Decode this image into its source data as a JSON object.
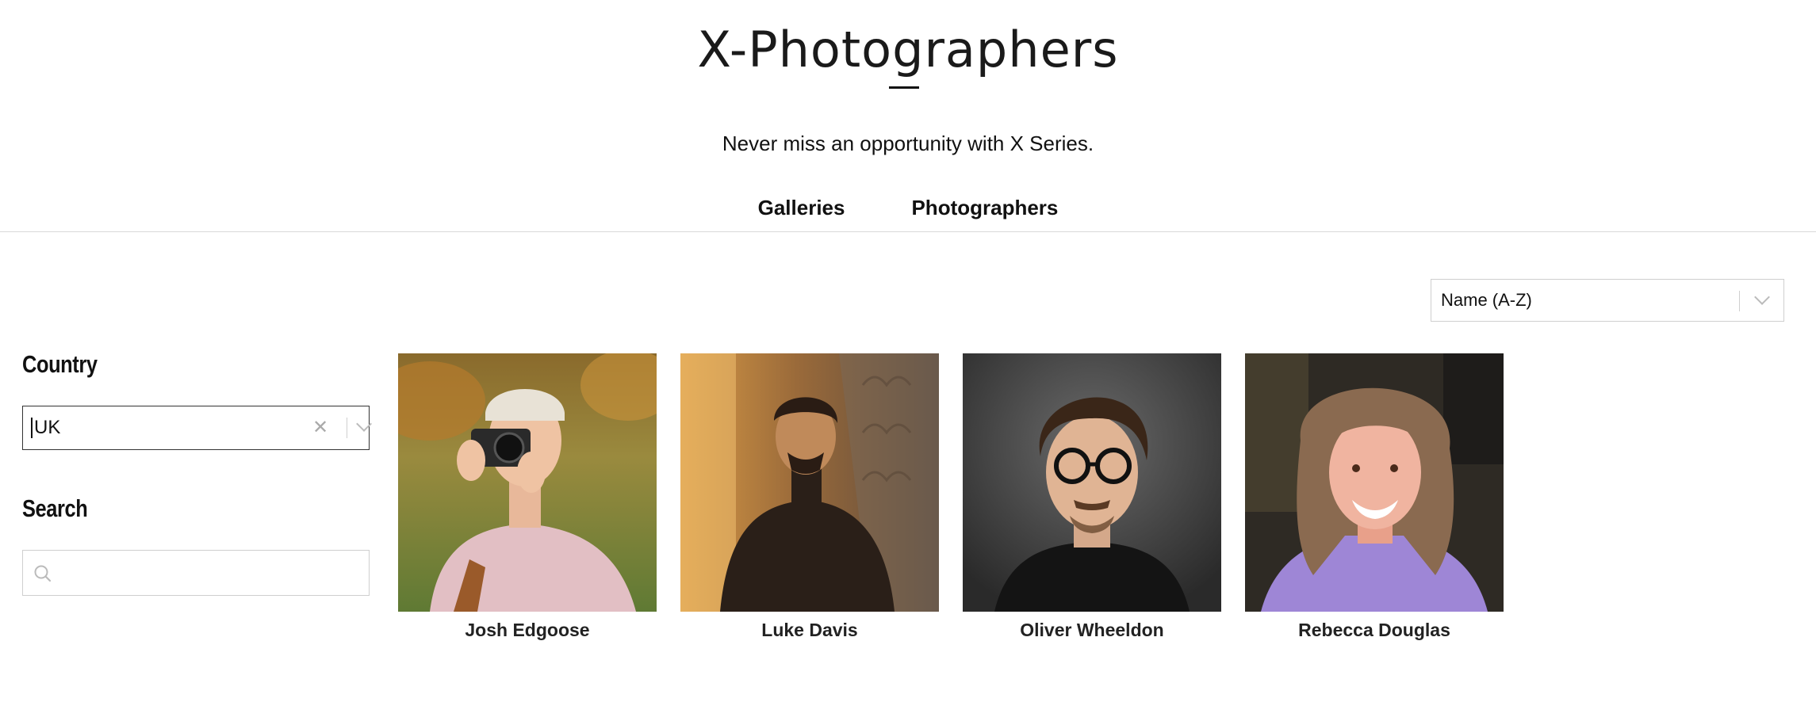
{
  "brand": {
    "logo_text": "X-Photographers"
  },
  "tagline": "Never miss an opportunity with X Series.",
  "nav": {
    "items": [
      {
        "label": "Galleries"
      },
      {
        "label": "Photographers"
      }
    ]
  },
  "sort": {
    "selected": "Name (A-Z)"
  },
  "filters": {
    "country": {
      "heading": "Country",
      "value": "UK"
    },
    "search": {
      "heading": "Search",
      "value": "",
      "placeholder": ""
    }
  },
  "photographers": [
    {
      "name": "Josh Edgoose"
    },
    {
      "name": "Luke Davis"
    },
    {
      "name": "Oliver Wheeldon"
    },
    {
      "name": "Rebecca Douglas"
    }
  ],
  "icons": {
    "sort_dropdown": "chevron-down-icon",
    "country_clear": "close-icon",
    "country_dropdown": "chevron-down-icon",
    "search": "search-icon"
  }
}
